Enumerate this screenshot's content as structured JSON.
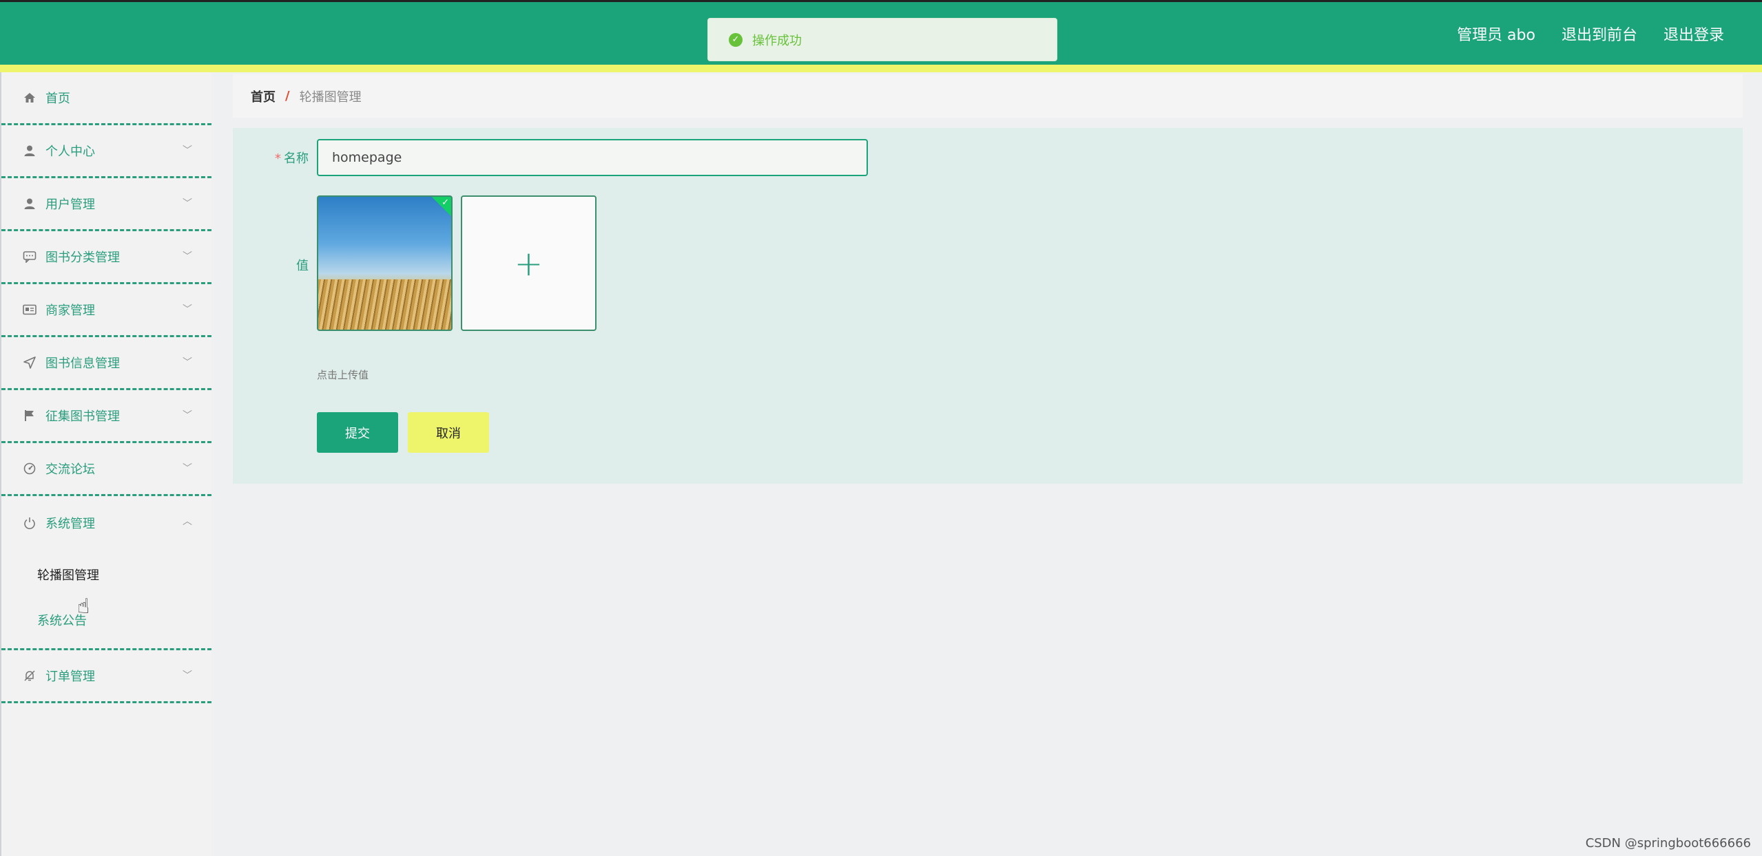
{
  "header": {
    "user_label": "管理员 abo",
    "to_front_label": "退出到前台",
    "logout_label": "退出登录"
  },
  "toast": {
    "message": "操作成功"
  },
  "sidebar": {
    "items": [
      {
        "label": "首页",
        "icon": "home-icon"
      },
      {
        "label": "个人中心",
        "icon": "user-icon"
      },
      {
        "label": "用户管理",
        "icon": "user-icon"
      },
      {
        "label": "图书分类管理",
        "icon": "chat-icon"
      },
      {
        "label": "商家管理",
        "icon": "id-card-icon"
      },
      {
        "label": "图书信息管理",
        "icon": "send-icon"
      },
      {
        "label": "征集图书管理",
        "icon": "flag-icon"
      },
      {
        "label": "交流论坛",
        "icon": "gauge-icon"
      },
      {
        "label": "系统管理",
        "icon": "power-icon",
        "expanded": true
      },
      {
        "label": "订单管理",
        "icon": "bell-off-icon"
      }
    ],
    "submenu": [
      {
        "label": "轮播图管理",
        "active": true
      },
      {
        "label": "系统公告",
        "active": false
      }
    ]
  },
  "breadcrumb": {
    "home": "首页",
    "separator": "/",
    "current": "轮播图管理"
  },
  "form": {
    "name_label": "名称",
    "name_value": "homepage",
    "value_label": "值",
    "upload_hint": "点击上传值",
    "submit_label": "提交",
    "cancel_label": "取消"
  },
  "watermark": "CSDN @springboot666666",
  "colors": {
    "primary": "#1ba47a",
    "accent_yellow": "#eef56b"
  }
}
